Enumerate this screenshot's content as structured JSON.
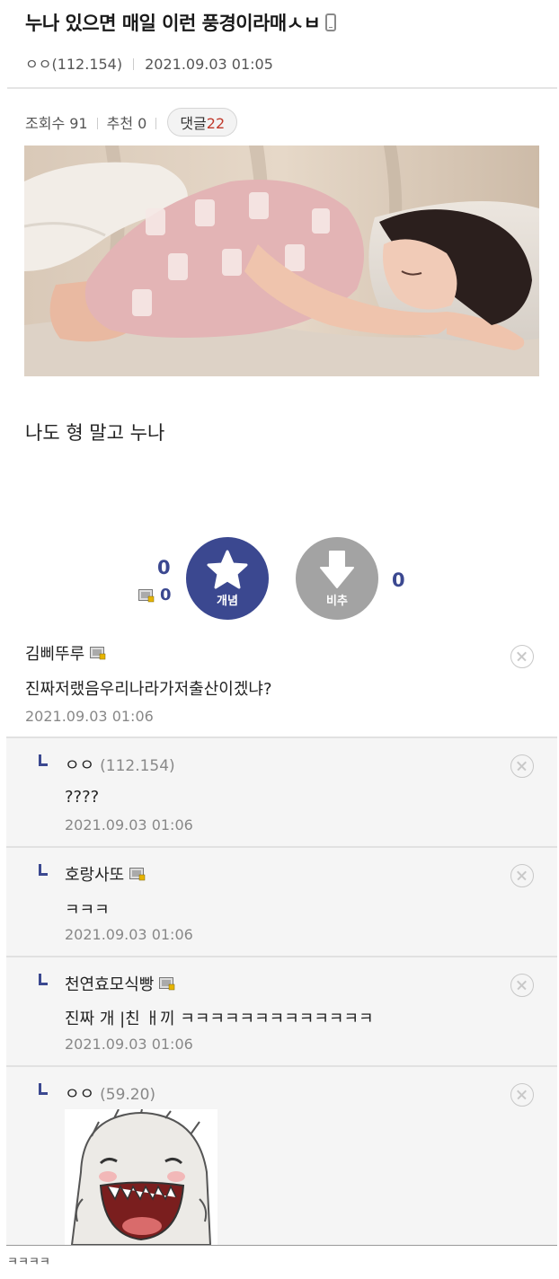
{
  "post": {
    "title": "누나 있으면 매일 이런 풍경이라매ㅅㅂ",
    "author_name": "ㅇㅇ",
    "author_ip": "(112.154)",
    "date": "2021.09.03 01:05",
    "icon": "mobile-icon"
  },
  "stats": {
    "views_label": "조회수 91",
    "recommend_label": "추천 0",
    "replies_label": "댓글",
    "replies_count": "22"
  },
  "body": {
    "image_alt": "photo of a sleeping woman",
    "text": "나도 형 말고 누나"
  },
  "vote": {
    "up_count": "0",
    "fixed_count": "0",
    "up_label": "개념",
    "down_label": "비추",
    "down_count": "0",
    "up_color": "#3b4890",
    "down_color": "#a3a3a3"
  },
  "comments": [
    {
      "nick": "김삐뚜루",
      "ip": "",
      "text": "진짜저랬음우리나라가저출산이겠냐?",
      "date": "2021.09.03 01:06",
      "reply": false
    },
    {
      "nick": "ㅇㅇ",
      "ip": "(112.154)",
      "text": "????",
      "date": "2021.09.03 01:06",
      "reply": true
    },
    {
      "nick": "호랑사또",
      "ip": "",
      "text": "ㅋㅋㅋ",
      "date": "2021.09.03 01:06",
      "reply": true
    },
    {
      "nick": "천연효모식빵",
      "ip": "",
      "text": "진짜 개 |친 ㅐ끼 ㅋㅋㅋㅋㅋㅋㅋㅋㅋㅋㅋㅋㅋ",
      "date": "2021.09.03 01:06",
      "reply": true
    },
    {
      "nick": "ㅇㅇ",
      "ip": "(59.20)",
      "text": "",
      "date": "",
      "reply": true
    }
  ],
  "footer": {
    "text": "ㅋㅋㅋㅋ"
  }
}
